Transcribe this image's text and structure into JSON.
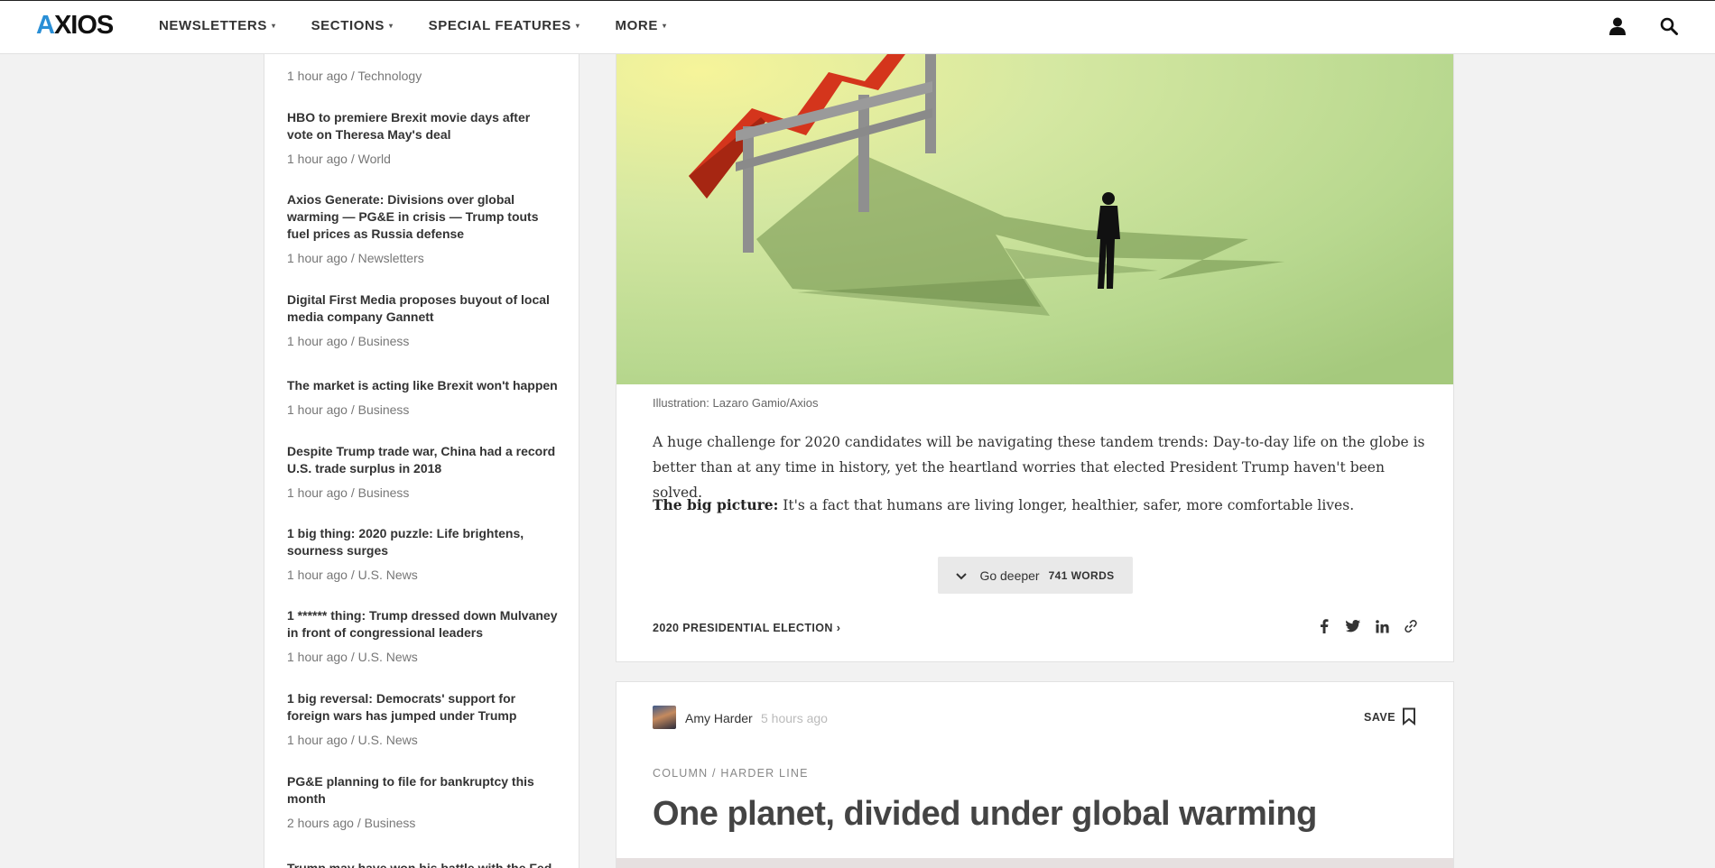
{
  "brand": {
    "logo_a": "A",
    "logo_rest": "XIOS"
  },
  "nav": {
    "items": [
      {
        "label": "NEWSLETTERS"
      },
      {
        "label": "SECTIONS"
      },
      {
        "label": "SPECIAL FEATURES"
      },
      {
        "label": "MORE"
      }
    ],
    "caret": "▾"
  },
  "sidebar": {
    "items": [
      {
        "title": "HBO to premiere Brexit movie days after vote on Theresa May's deal",
        "meta": "1 hour ago / World"
      },
      {
        "title": "Axios Generate: Divisions over global warming — PG&E in crisis — Trump touts fuel prices as Russia defense",
        "meta": "1 hour ago / Newsletters"
      },
      {
        "title": "Digital First Media proposes buyout of local media company Gannett",
        "meta": "1 hour ago / Business"
      },
      {
        "title": "The market is acting like Brexit won't happen",
        "meta": "1 hour ago / Business"
      },
      {
        "title": "Despite Trump trade war, China had a record U.S. trade surplus in 2018",
        "meta": "1 hour ago / Business"
      },
      {
        "title": "1 big thing: 2020 puzzle: Life brightens, sourness surges",
        "meta": "1 hour ago / U.S. News"
      },
      {
        "title": "1 ****** thing: Trump dressed down Mulvaney in front of congressional leaders",
        "meta": "1 hour ago / U.S. News"
      },
      {
        "title": "1 big reversal: Democrats' support for foreign wars has jumped under Trump",
        "meta": "1 hour ago / U.S. News"
      },
      {
        "title": "PG&E planning to file for bankruptcy this month",
        "meta": "2 hours ago / Business"
      },
      {
        "title": "Trump may have won his battle with the Fed",
        "meta": ""
      }
    ],
    "top_meta": "1 hour ago / Technology"
  },
  "article": {
    "caption": "Illustration: Lazaro Gamio/Axios",
    "paragraph1": "A huge challenge for 2020 candidates will be navigating these tandem trends: Day-to-day life on the globe is better than at any time in history, yet the heartland worries that elected President Trump haven't been solved.",
    "bigpicture_label": "The big picture:",
    "bigpicture_text": " It's a fact that humans are living longer, healthier, safer, more comfortable lives.",
    "go_deeper_label": "Go deeper",
    "go_deeper_words": "741 WORDS",
    "topic_label": "2020 PRESIDENTIAL ELECTION",
    "topic_arrow": "›"
  },
  "next_article": {
    "author": "Amy Harder",
    "time": "5 hours ago",
    "save_label": "SAVE",
    "kicker": "COLUMN / HARDER LINE",
    "headline": "One planet, divided under global warming"
  },
  "colors": {
    "brand_blue": "#2a8fd6",
    "illustration_green": "#b8d88f",
    "arrow_red": "#d4351c"
  }
}
